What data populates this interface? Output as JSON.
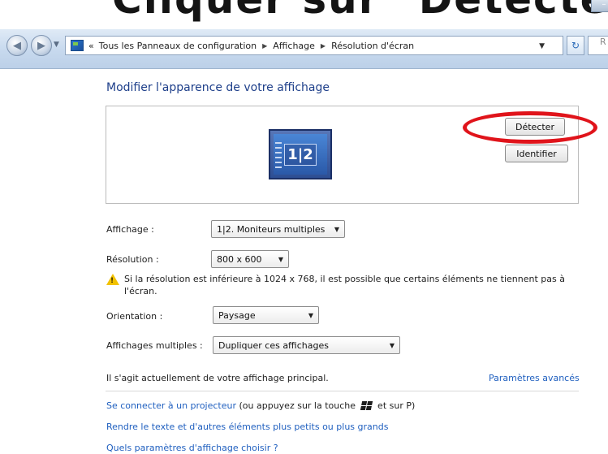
{
  "banner": {
    "text": "Cliquer sur \"Détecter\""
  },
  "toolbar": {
    "breadcrumb_prefix": "«",
    "crumbs": [
      "Tous les Panneaux de configuration",
      "Affichage",
      "Résolution d'écran"
    ],
    "search_placeholder": "R"
  },
  "main": {
    "title": "Modifier l'apparence de votre affichage",
    "monitor_label": "1|2",
    "detect_label": "Détecter",
    "identify_label": "Identifier"
  },
  "settings": {
    "display_label": "Affichage :",
    "display_value": "1|2. Moniteurs multiples",
    "resolution_label": "Résolution :",
    "resolution_value": "800 x 600",
    "warning": "Si la résolution est inférieure à 1024 x 768, il est possible que certains éléments ne tiennent pas à l'écran.",
    "orientation_label": "Orientation :",
    "orientation_value": "Paysage",
    "multiple_label": "Affichages multiples :",
    "multiple_value": "Dupliquer ces affichages"
  },
  "footer": {
    "principal_text": "Il s'agit actuellement de votre affichage principal.",
    "advanced_link": "Paramètres avancés",
    "projector_link": "Se connecter à un projecteur",
    "projector_text_before": "(ou appuyez sur la touche",
    "projector_text_after": "et sur P)",
    "text_size_link": "Rendre le texte et d'autres éléments plus petits ou plus grands",
    "which_settings_link": "Quels paramètres d'affichage choisir ?"
  },
  "colors": {
    "link": "#1f5fbf",
    "title": "#1e3f8a",
    "highlight": "#e0141b",
    "warning": "#f2c200"
  },
  "icons": [
    "back-icon",
    "forward-icon",
    "control-panel-icon",
    "refresh-icon",
    "monitor-icon",
    "warning-icon",
    "windows-logo-icon"
  ]
}
